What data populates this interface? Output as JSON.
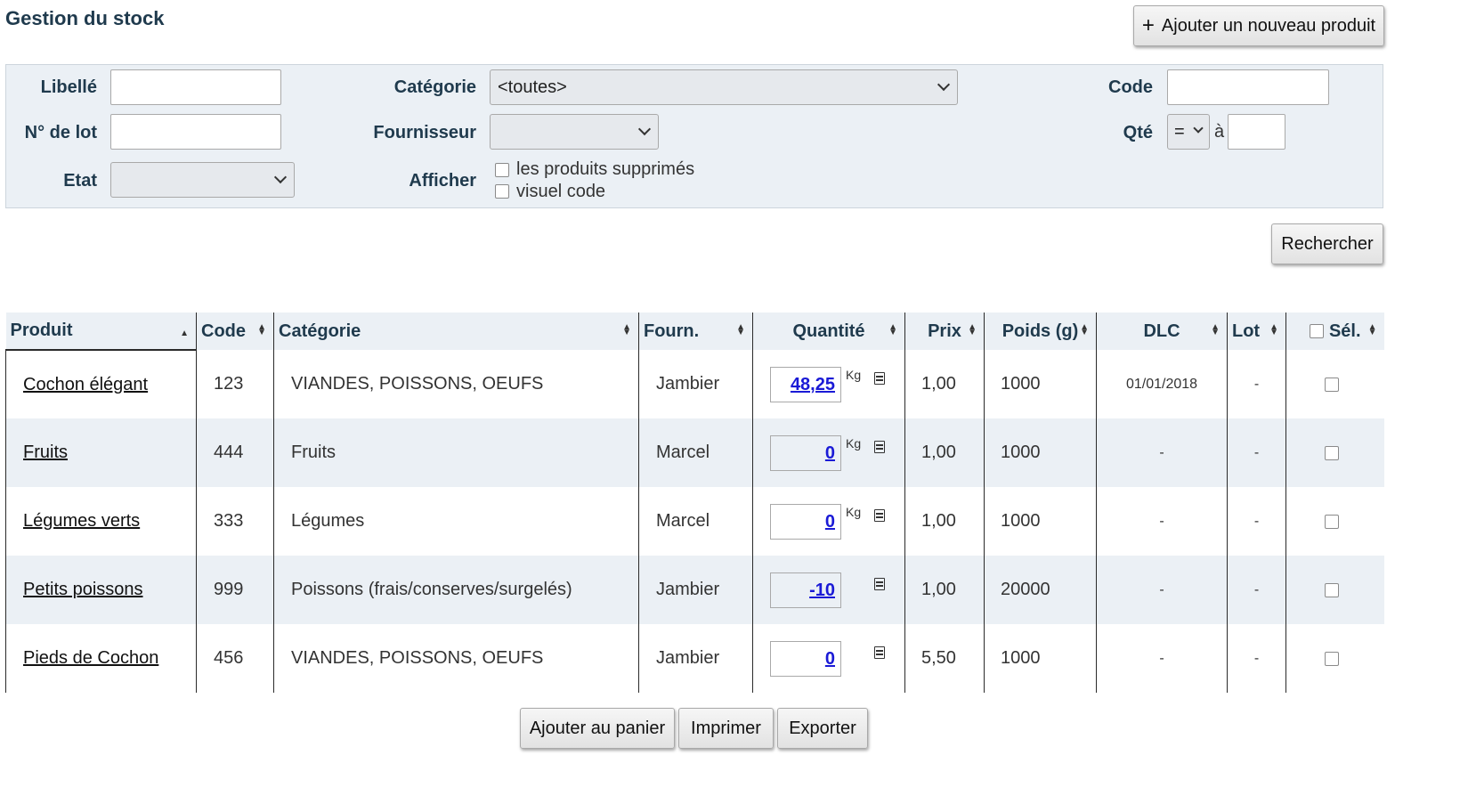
{
  "page": {
    "title": "Gestion du stock",
    "add_product_label": "Ajouter un nouveau produit"
  },
  "filters": {
    "libelle_label": "Libellé",
    "libelle_value": "",
    "lot_label": "N° de lot",
    "lot_value": "",
    "etat_label": "Etat",
    "etat_value": "",
    "categorie_label": "Catégorie",
    "categorie_value": "<toutes>",
    "fournisseur_label": "Fournisseur",
    "fournisseur_value": "",
    "afficher_label": "Afficher",
    "show_deleted_label": "les produits supprimés",
    "show_code_visual_label": "visuel code",
    "code_label": "Code",
    "code_value": "",
    "qte_label": "Qté",
    "qte_operator": "=",
    "qte_a_label": "à",
    "qte_value": ""
  },
  "search_label": "Rechercher",
  "table": {
    "columns": {
      "produit": "Produit",
      "code": "Code",
      "categorie": "Catégorie",
      "fourn": "Fourn.",
      "quantite": "Quantité",
      "prix": "Prix",
      "poids": "Poids (g)",
      "dlc": "DLC",
      "lot": "Lot",
      "sel": "Sél."
    },
    "rows": [
      {
        "produit": "Cochon élégant",
        "code": "123",
        "categorie": "VIANDES, POISSONS, OEUFS",
        "fourn": "Jambier",
        "quantite": "48,25",
        "unit": "Kg",
        "prix": "1,00",
        "poids": "1000",
        "dlc": "01/01/2018",
        "lot": "-"
      },
      {
        "produit": "Fruits",
        "code": "444",
        "categorie": "Fruits",
        "fourn": "Marcel",
        "quantite": "0",
        "unit": "Kg",
        "prix": "1,00",
        "poids": "1000",
        "dlc": "-",
        "lot": "-"
      },
      {
        "produit": "Légumes verts",
        "code": "333",
        "categorie": "Légumes",
        "fourn": "Marcel",
        "quantite": "0",
        "unit": "Kg",
        "prix": "1,00",
        "poids": "1000",
        "dlc": "-",
        "lot": "-"
      },
      {
        "produit": "Petits poissons",
        "code": "999",
        "categorie": "Poissons (frais/conserves/surgelés)",
        "fourn": "Jambier",
        "quantite": "-10",
        "unit": "",
        "prix": "1,00",
        "poids": "20000",
        "dlc": "-",
        "lot": "-"
      },
      {
        "produit": "Pieds de Cochon",
        "code": "456",
        "categorie": "VIANDES, POISSONS, OEUFS",
        "fourn": "Jambier",
        "quantite": "0",
        "unit": "",
        "prix": "5,50",
        "poids": "1000",
        "dlc": "-",
        "lot": "-"
      }
    ]
  },
  "actions": {
    "cart_label": "Ajouter au panier",
    "print_label": "Imprimer",
    "export_label": "Exporter"
  },
  "icons": {
    "add": "plus-icon",
    "dropdown": "chevron-down-icon",
    "sort": "sort-icon",
    "list": "list-icon"
  }
}
